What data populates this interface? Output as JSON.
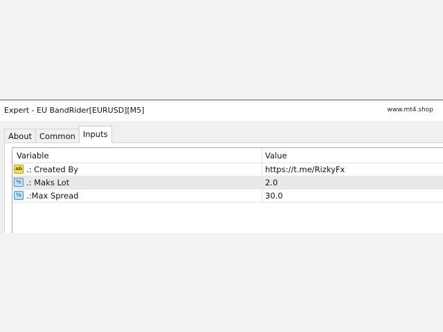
{
  "window": {
    "title": "Expert - EU BandRider[EURUSD][M5]",
    "watermark": "www.mt4.shop"
  },
  "tabs": [
    {
      "label": "About",
      "active": false
    },
    {
      "label": "Common",
      "active": false
    },
    {
      "label": "Inputs",
      "active": true
    }
  ],
  "grid": {
    "columns": {
      "variable": "Variable",
      "value": "Value"
    },
    "rows": [
      {
        "icon": "ab",
        "icon_name": "string-type-icon",
        "variable": ".: Created By",
        "value": "https://t.me/RizkyFx",
        "selected": false
      },
      {
        "icon": "½",
        "icon_name": "double-type-icon",
        "variable": ".: Maks Lot",
        "value": "2.0",
        "selected": true
      },
      {
        "icon": "½",
        "icon_name": "double-type-icon",
        "variable": ".:Max Spread",
        "value": "30.0",
        "selected": false
      }
    ]
  },
  "colors": {
    "page_background": "#f3f3f6",
    "selected_row": "#e9e9e9",
    "string_icon": "#f5e45a",
    "number_icon": "#bfe2f7"
  }
}
